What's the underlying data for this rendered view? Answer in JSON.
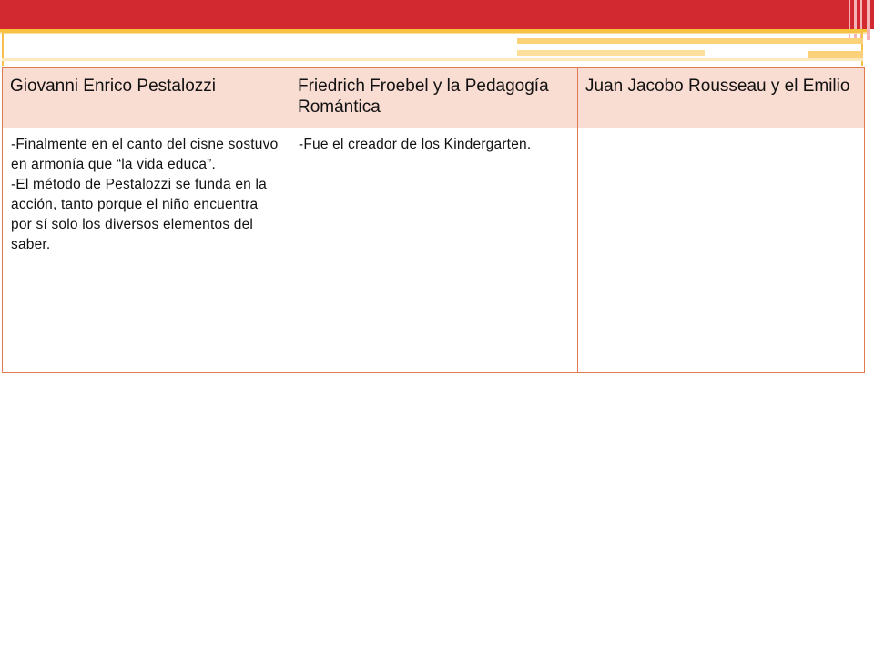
{
  "table": {
    "headers": [
      "Giovanni Enrico Pestalozzi",
      "Friedrich Froebel y la Pedagogía Romántica",
      "Juan Jacobo Rousseau y el Emilio"
    ],
    "cells": {
      "pestalozzi": [
        "-Finalmente en el canto del cisne sostuvo en armonía que “la vida educa”.",
        "-El método de Pestalozzi se funda en la acción, tanto porque el niño encuentra por sí solo los diversos elementos del saber."
      ],
      "froebel": [
        "-Fue el creador de los Kindergarten."
      ],
      "rousseau": []
    }
  },
  "theme": {
    "banner_color": "#d2282f",
    "accent_gold": "#f9c338",
    "table_border": "#e07a52",
    "header_fill": "#f9dcd2"
  }
}
